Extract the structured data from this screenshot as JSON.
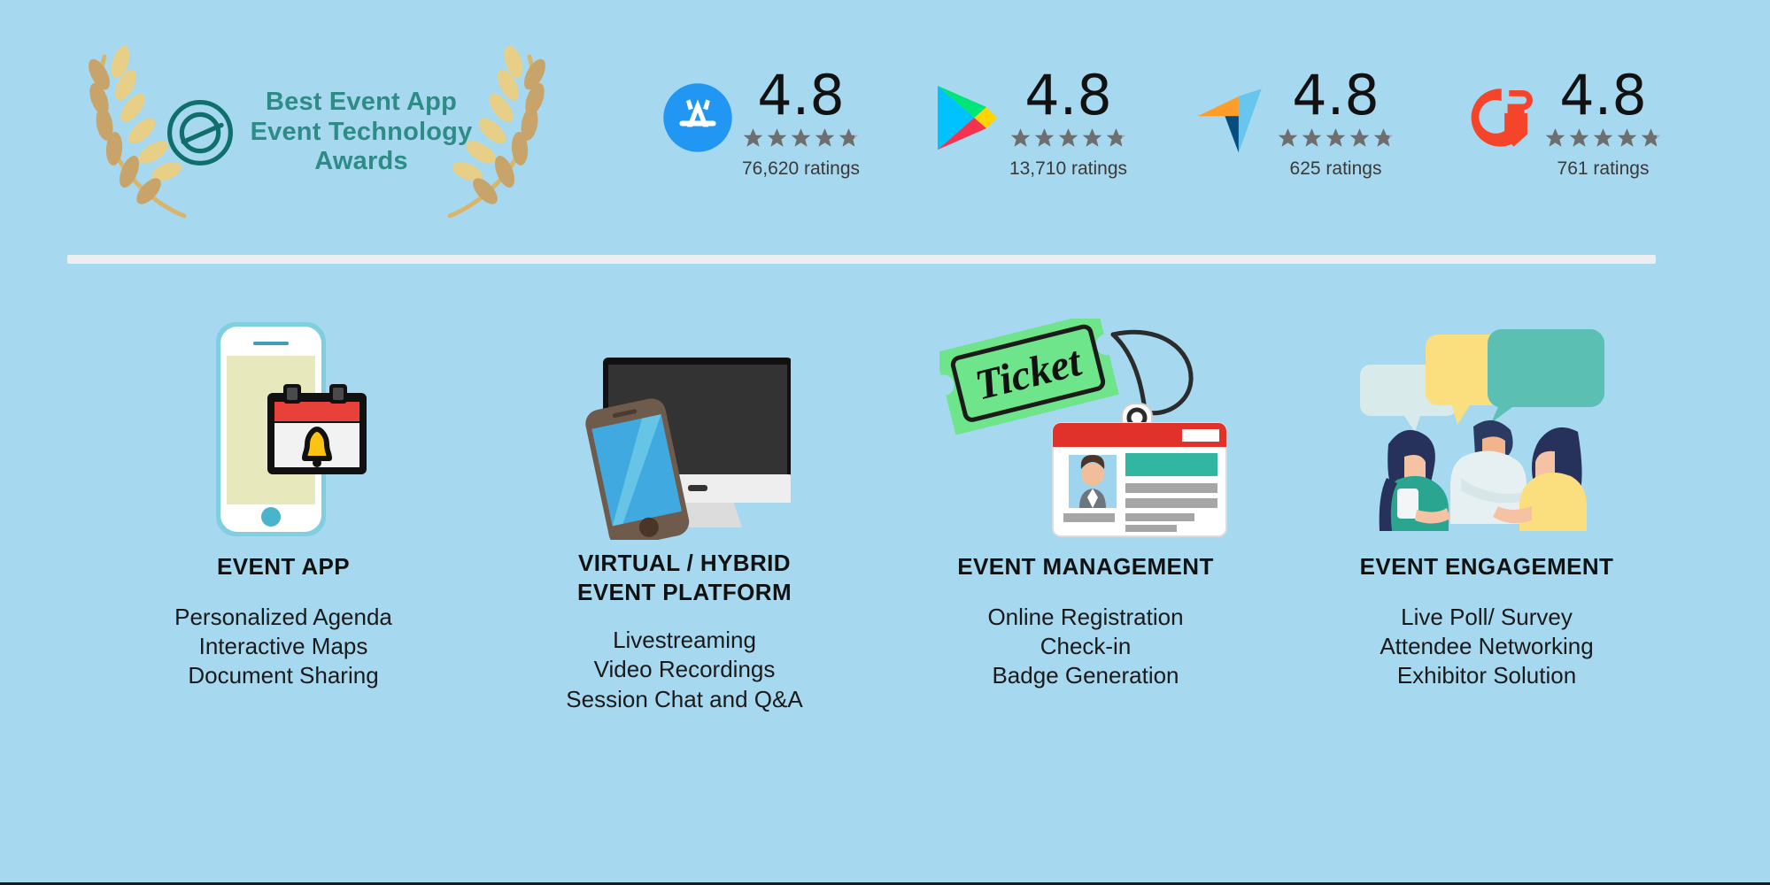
{
  "award": {
    "logo_icon": "eta-circle-e-icon",
    "laurel_left_icon": "laurel-wreath-left-icon",
    "laurel_right_icon": "laurel-wreath-right-icon",
    "line1": "Best Event App",
    "line2": "Event Technology",
    "line3": "Awards",
    "color": "#2e8b86"
  },
  "ratings": [
    {
      "platform": "App Store",
      "logo_icon": "app-store-icon",
      "score": "4.8",
      "stars": 4.8,
      "count": "76,620 ratings"
    },
    {
      "platform": "Google Play",
      "logo_icon": "google-play-icon",
      "score": "4.8",
      "stars": 4.8,
      "count": "13,710 ratings"
    },
    {
      "platform": "Capterra",
      "logo_icon": "capterra-icon",
      "score": "4.8",
      "stars": 4.8,
      "count": "625 ratings"
    },
    {
      "platform": "G2",
      "logo_icon": "g2-icon",
      "score": "4.8",
      "stars": 4.8,
      "count": "761 ratings"
    }
  ],
  "features": [
    {
      "art_icon": "phone-calendar-notification-icon",
      "title": "EVENT APP",
      "items": [
        "Personalized Agenda",
        "Interactive Maps",
        "Document Sharing"
      ]
    },
    {
      "art_icon": "monitor-smartphone-icon",
      "title": "VIRTUAL / HYBRID\nEVENT PLATFORM",
      "title_line1": "VIRTUAL / HYBRID",
      "title_line2": "EVENT PLATFORM",
      "items": [
        "Livestreaming",
        "Video Recordings",
        "Session Chat and Q&A"
      ]
    },
    {
      "art_icon": "ticket-id-badge-icon",
      "title": "EVENT MANAGEMENT",
      "items": [
        "Online Registration",
        "Check-in",
        "Badge Generation"
      ]
    },
    {
      "art_icon": "people-speech-bubbles-icon",
      "title": "EVENT ENGAGEMENT",
      "items": [
        "Live Poll/ Survey",
        "Attendee Networking",
        "Exhibitor Solution"
      ]
    }
  ],
  "theme": {
    "background": "#a6d8f0",
    "divider": "#edeef0",
    "star_color": "#6e6e6e",
    "text_color": "#111111"
  }
}
